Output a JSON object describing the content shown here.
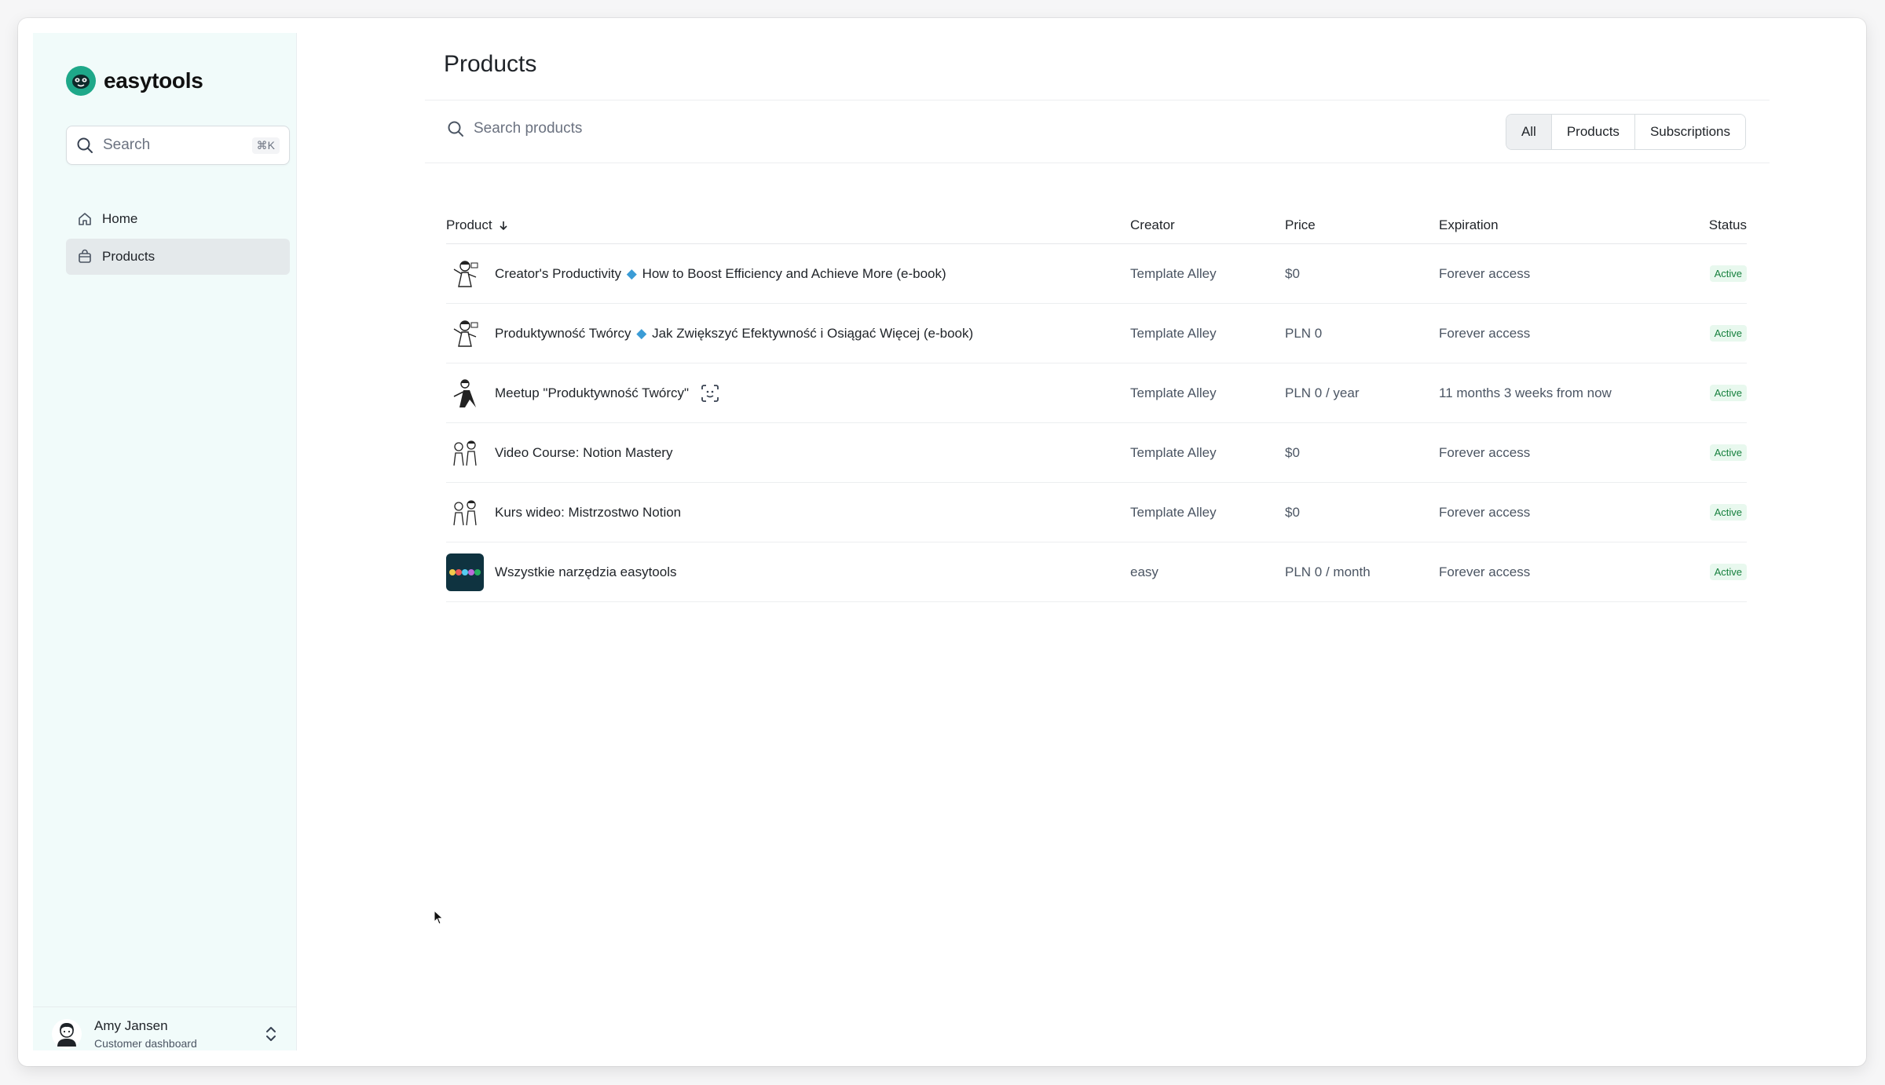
{
  "brand": {
    "name": "easytools"
  },
  "sidebar": {
    "search": {
      "placeholder": "Search",
      "shortcut": "⌘K"
    },
    "items": [
      {
        "label": "Home",
        "icon": "home-icon",
        "active": false
      },
      {
        "label": "Products",
        "icon": "bag-icon",
        "active": true
      }
    ],
    "user": {
      "name": "Amy Jansen",
      "role": "Customer dashboard"
    }
  },
  "main": {
    "title": "Products",
    "search": {
      "placeholder": "Search products"
    },
    "filters": [
      {
        "label": "All",
        "active": true
      },
      {
        "label": "Products",
        "active": false
      },
      {
        "label": "Subscriptions",
        "active": false
      }
    ],
    "table": {
      "columns": [
        "Product",
        "Creator",
        "Price",
        "Expiration",
        "Status"
      ],
      "rows": [
        {
          "name_before": "Creator's Productivity",
          "name_after": "How to Boost Efficiency and Achieve More (e-book)",
          "creator": "Template Alley",
          "price": "$0",
          "expiration": "Forever access",
          "status": "Active"
        },
        {
          "name_before": "Produktywność Twórcy",
          "name_after": "Jak Zwiększyć Efektywność i Osiągać Więcej (e-book)",
          "creator": "Template Alley",
          "price": "PLN 0",
          "expiration": "Forever access",
          "status": "Active"
        },
        {
          "name": "Meetup \"Produktywność Twórcy\"",
          "creator": "Template Alley",
          "price": "PLN 0 / year",
          "expiration": "11 months 3 weeks from now",
          "status": "Active"
        },
        {
          "name": "Video Course: Notion Mastery",
          "creator": "Template Alley",
          "price": "$0",
          "expiration": "Forever access",
          "status": "Active"
        },
        {
          "name": "Kurs wideo: Mistrzostwo Notion",
          "creator": "Template Alley",
          "price": "$0",
          "expiration": "Forever access",
          "status": "Active"
        },
        {
          "name": "Wszystkie narzędzia easytools",
          "creator": "easy",
          "price": "PLN 0 / month",
          "expiration": "Forever access",
          "status": "Active"
        }
      ]
    }
  },
  "colors": {
    "accent": "#1ea889",
    "status_active": "#15803d",
    "sidebar_bg": "#f1fbfa"
  }
}
